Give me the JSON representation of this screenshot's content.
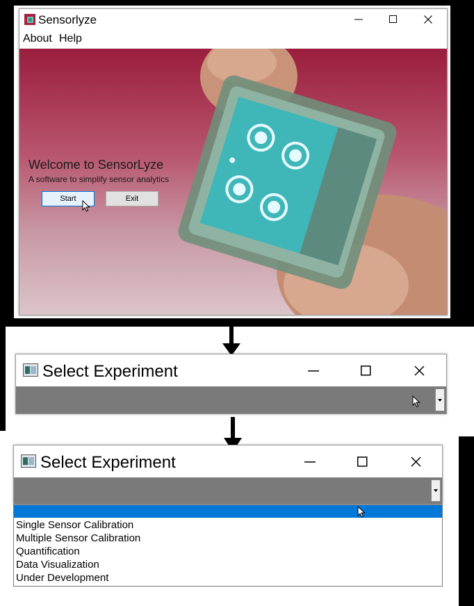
{
  "window1": {
    "title": "Sensorlyze",
    "menu": [
      "About",
      "Help"
    ],
    "welcome_title": "Welcome to SensorLyze",
    "tagline": "A software to simplify sensor analytics",
    "start_label": "Start",
    "exit_label": "Exit"
  },
  "window2": {
    "title": "Select Experiment"
  },
  "window3": {
    "title": "Select Experiment",
    "options": [
      "",
      "Single Sensor Calibration",
      "Multiple Sensor Calibration",
      "Quantification",
      "Data Visualization",
      "Under Development"
    ],
    "selected_index": 0
  },
  "icons": [
    "app-icon",
    "minimize-icon",
    "maximize-icon",
    "close-icon",
    "dropdown-arrow-icon",
    "mouse-cursor-icon",
    "down-arrow-icon"
  ],
  "colors": {
    "selection": "#0078d7",
    "combo_bg": "#7a7a7a",
    "hero_top": "#9a1d3d"
  }
}
